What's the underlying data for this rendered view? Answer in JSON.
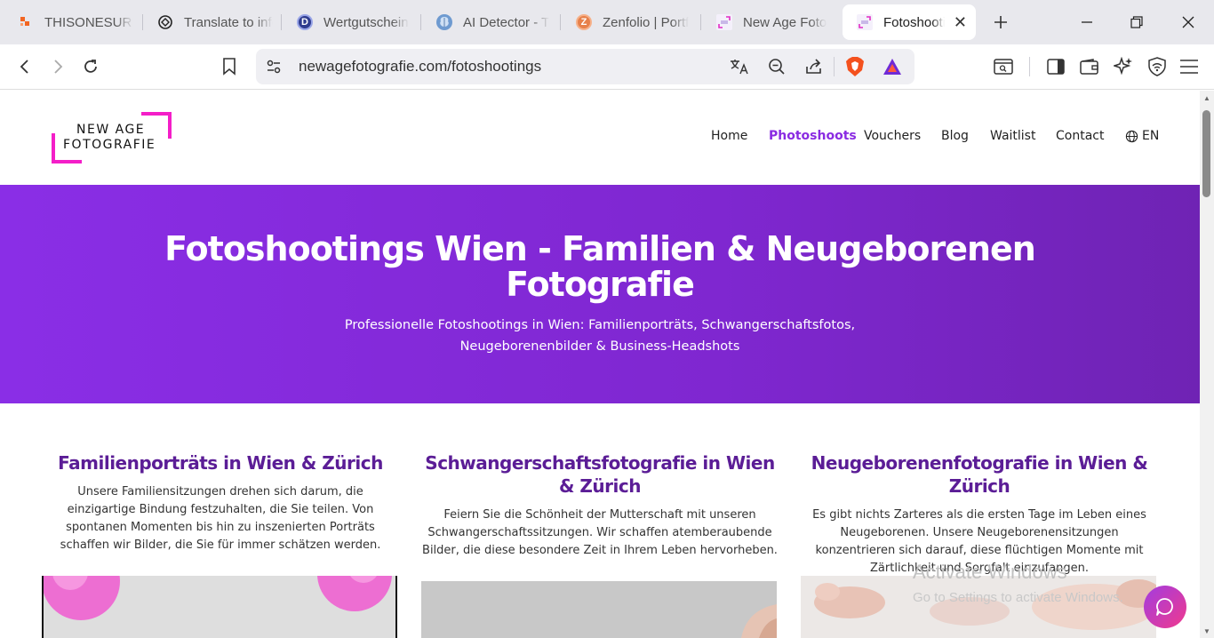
{
  "browser": {
    "tabs": [
      {
        "label": "THISONESURE",
        "icon": "orange-brand-icon"
      },
      {
        "label": "Translate to info",
        "icon": "chatgpt-icon"
      },
      {
        "label": "Wertgutschein",
        "icon": "d-circle-icon"
      },
      {
        "label": "AI Detector - T",
        "icon": "brain-icon"
      },
      {
        "label": "Zenfolio | Portf",
        "icon": "zenfolio-icon"
      },
      {
        "label": "New Age Foto",
        "icon": "newage-favicon"
      },
      {
        "label": "Fotoshootings",
        "icon": "newage-favicon",
        "active": true
      }
    ],
    "url": "newagefotografie.com/fotoshootings"
  },
  "site": {
    "logo": {
      "line1": "NEW AGE",
      "line2": "FOTOGRAFIE",
      "color": "#f41ec8"
    },
    "nav": [
      {
        "label": "Home"
      },
      {
        "label": "Photoshoots",
        "active": true
      },
      {
        "label": "Vouchers"
      },
      {
        "label": "Blog"
      },
      {
        "label": "Waitlist"
      },
      {
        "label": "Contact"
      },
      {
        "label": "EN"
      }
    ],
    "accent": "#8a2be2",
    "hero": {
      "title": "Fotoshootings Wien - Familien & Neugeborenen Fotografie",
      "subtitle": "Professionelle Fotoshootings in Wien: Familienporträts, Schwangerschaftsfotos, Neugeborenenbilder & Business-Headshots"
    },
    "services": [
      {
        "title": "Familienporträts in Wien & Zürich",
        "text": "Unsere Familiensitzungen drehen sich darum, die einzigartige Bindung festzuhalten, die Sie teilen. Von spontanen Momenten bis hin zu inszenierten Porträts schaffen wir Bilder, die Sie für immer schätzen werden."
      },
      {
        "title": "Schwangerschaftsfotografie in Wien & Zürich",
        "text": "Feiern Sie die Schönheit der Mutterschaft mit unseren Schwangerschaftssitzungen. Wir schaffen atemberaubende Bilder, die diese besondere Zeit in Ihrem Leben hervorheben."
      },
      {
        "title": "Neugeborenenfotografie in Wien & Zürich",
        "text": "Es gibt nichts Zarteres als die ersten Tage im Leben eines Neugeborenen. Unsere Neugeborenensitzungen konzentrieren sich darauf, diese flüchtigen Momente mit Zärtlichkeit und Sorgfalt einzufangen."
      }
    ]
  },
  "overlay": {
    "activate_title": "Activate Windows",
    "activate_sub": "Go to Settings to activate Windows."
  }
}
